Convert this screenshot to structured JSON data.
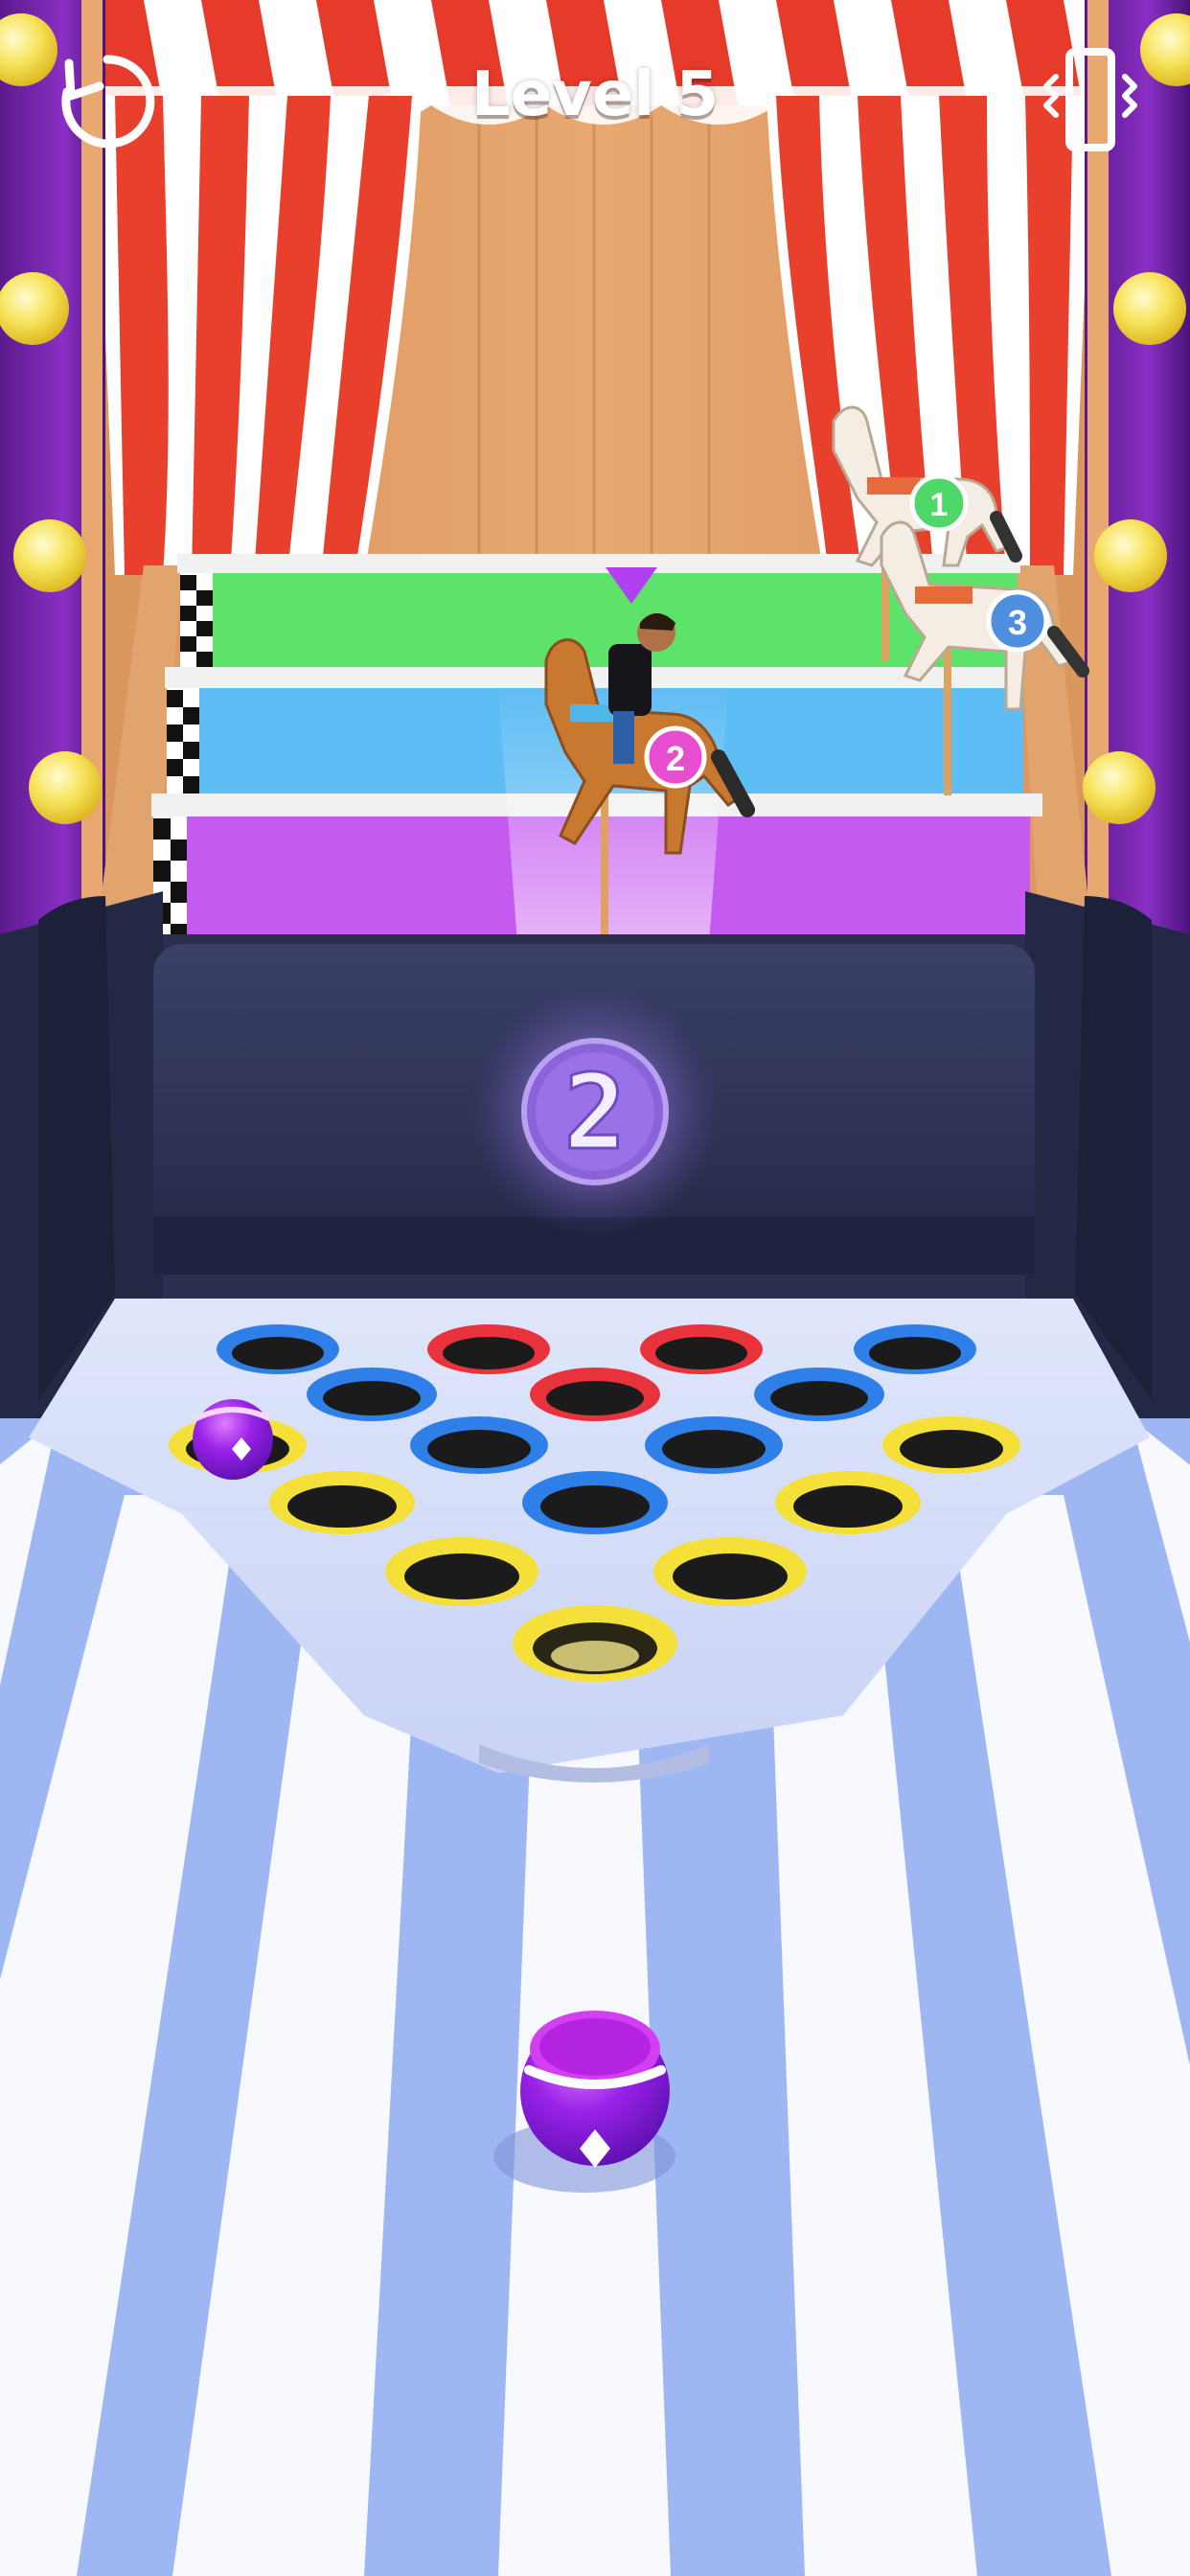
{
  "hud": {
    "level_title": "Level 5",
    "restart_icon": "restart-icon",
    "vibration_icon": "vibration-toggle-icon"
  },
  "race": {
    "lanes": [
      {
        "color": "#5ee36a",
        "name": "lane-green"
      },
      {
        "color": "#5fbdf5",
        "name": "lane-blue"
      },
      {
        "color": "#c55af0",
        "name": "lane-purple"
      }
    ],
    "racers": [
      {
        "number": "1",
        "badge_color": "#4fd86a"
      },
      {
        "number": "2",
        "badge_color": "#e84fd0"
      },
      {
        "number": "3",
        "badge_color": "#4f8fe0"
      }
    ],
    "leader_marker": "purple-triangle-marker"
  },
  "board": {
    "counter_value": "2"
  },
  "holes": {
    "colors": {
      "blue": "#2f7fe8",
      "red": "#e8323c",
      "yellow": "#f5e03a"
    }
  },
  "ball": {
    "color": "#a12ff0",
    "icon": "diamond-icon"
  }
}
